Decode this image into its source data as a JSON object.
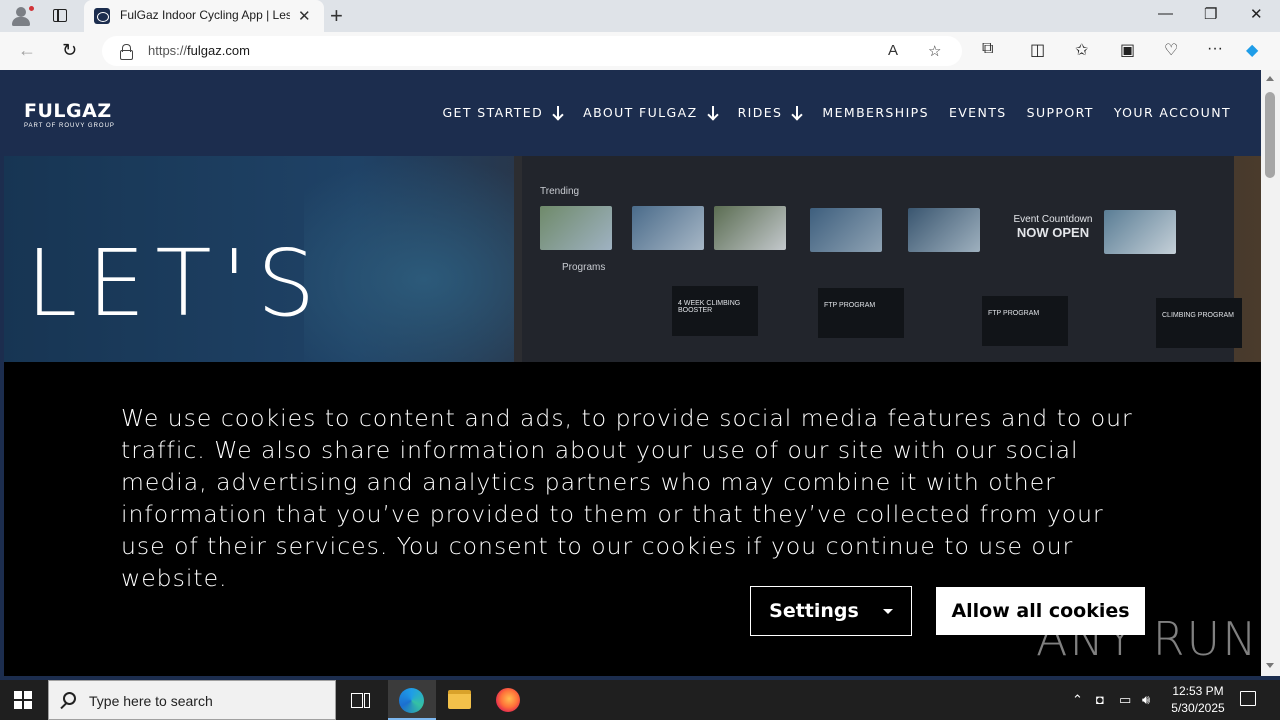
{
  "browser": {
    "tab_title": "FulGaz Indoor Cycling App | Less",
    "new_tab_symbol": "+",
    "url_scheme": "https://",
    "url_host": "fulgaz.com",
    "minimize": "—",
    "maximize": "❐",
    "close": "✕"
  },
  "site": {
    "logo_word": "FULGAZ",
    "logo_tag": "PART OF ROUVY GROUP",
    "nav": [
      {
        "label": "GET STARTED",
        "has_dropdown": true
      },
      {
        "label": "ABOUT FULGAZ",
        "has_dropdown": true
      },
      {
        "label": "RIDES",
        "has_dropdown": true
      },
      {
        "label": "MEMBERSHIPS",
        "has_dropdown": false
      },
      {
        "label": "EVENTS",
        "has_dropdown": false
      },
      {
        "label": "SUPPORT",
        "has_dropdown": false
      },
      {
        "label": "YOUR ACCOUNT",
        "has_dropdown": false
      }
    ],
    "hero_title": "LET'S",
    "hero_screen": {
      "trending_label": "Trending",
      "programs_label": "Programs",
      "countdown_line1": "Event Countdown",
      "countdown_line2": "NOW OPEN",
      "cards": [
        "4 WEEK CLIMBING BOOSTER",
        "FTP PROGRAM",
        "FTP PROGRAM",
        "CLIMBING PROGRAM"
      ]
    }
  },
  "cookie_banner": {
    "text": "We use cookies to content and ads, to provide social media features and to our traffic. We also share information about your use of our site with our social media, advertising and analytics partners who may combine it with other information that you’ve provided to them or that they’ve collected from your use of their services. You consent to our cookies if you continue to use our website.",
    "settings_label": "Settings",
    "allow_label": "Allow all cookies"
  },
  "watermark": "ANY RUN",
  "taskbar": {
    "search_placeholder": "Type here to search",
    "time": "12:53 PM",
    "date": "5/30/2025"
  },
  "colors": {
    "site_header": "#1c2d4e",
    "cookie_bg": "#000000",
    "taskbar": "#1f1f1f"
  }
}
